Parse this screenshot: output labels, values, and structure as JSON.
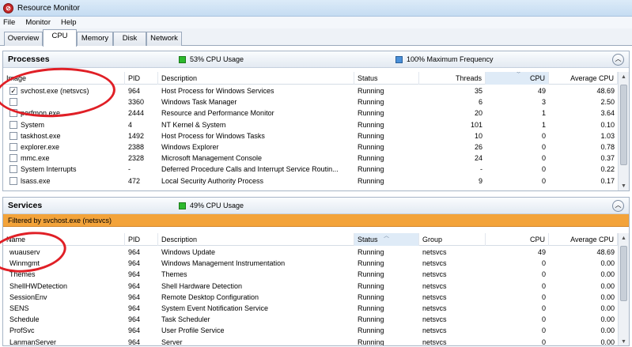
{
  "window": {
    "title": "Resource Monitor"
  },
  "menu": [
    "File",
    "Monitor",
    "Help"
  ],
  "tabs": [
    "Overview",
    "CPU",
    "Memory",
    "Disk",
    "Network"
  ],
  "processes": {
    "title": "Processes",
    "cpu_usage": "53% CPU Usage",
    "max_freq": "100% Maximum Frequency",
    "columns": [
      "Image",
      "PID",
      "Description",
      "Status",
      "Threads",
      "CPU",
      "Average CPU"
    ],
    "rows": [
      {
        "checked": true,
        "image": "svchost.exe (netsvcs)",
        "pid": "964",
        "desc": "Host Process for Windows Services",
        "status": "Running",
        "threads": "35",
        "cpu": "49",
        "avg": "48.69"
      },
      {
        "checked": false,
        "image": "",
        "pid": "3360",
        "desc": "Windows Task Manager",
        "status": "Running",
        "threads": "6",
        "cpu": "3",
        "avg": "2.50"
      },
      {
        "checked": false,
        "image": "perfmon.exe",
        "pid": "2444",
        "desc": "Resource and Performance Monitor",
        "status": "Running",
        "threads": "20",
        "cpu": "1",
        "avg": "3.64"
      },
      {
        "checked": false,
        "image": "System",
        "pid": "4",
        "desc": "NT Kernel & System",
        "status": "Running",
        "threads": "101",
        "cpu": "1",
        "avg": "0.10"
      },
      {
        "checked": false,
        "image": "taskhost.exe",
        "pid": "1492",
        "desc": "Host Process for Windows Tasks",
        "status": "Running",
        "threads": "10",
        "cpu": "0",
        "avg": "1.03"
      },
      {
        "checked": false,
        "image": "explorer.exe",
        "pid": "2388",
        "desc": "Windows Explorer",
        "status": "Running",
        "threads": "26",
        "cpu": "0",
        "avg": "0.78"
      },
      {
        "checked": false,
        "image": "mmc.exe",
        "pid": "2328",
        "desc": "Microsoft Management Console",
        "status": "Running",
        "threads": "24",
        "cpu": "0",
        "avg": "0.37"
      },
      {
        "checked": false,
        "image": "System Interrupts",
        "pid": "-",
        "desc": "Deferred Procedure Calls and Interrupt Service Routin...",
        "status": "Running",
        "threads": "-",
        "cpu": "0",
        "avg": "0.22"
      },
      {
        "checked": false,
        "image": "lsass.exe",
        "pid": "472",
        "desc": "Local Security Authority Process",
        "status": "Running",
        "threads": "9",
        "cpu": "0",
        "avg": "0.17"
      }
    ]
  },
  "services": {
    "title": "Services",
    "cpu_usage": "49% CPU Usage",
    "filter_text": "Filtered by svchost.exe (netsvcs)",
    "columns": [
      "Name",
      "PID",
      "Description",
      "Status",
      "Group",
      "CPU",
      "Average CPU"
    ],
    "rows": [
      {
        "name": "wuauserv",
        "pid": "964",
        "desc": "Windows Update",
        "status": "Running",
        "group": "netsvcs",
        "cpu": "49",
        "avg": "48.69"
      },
      {
        "name": "Winmgmt",
        "pid": "964",
        "desc": "Windows Management Instrumentation",
        "status": "Running",
        "group": "netsvcs",
        "cpu": "0",
        "avg": "0.00"
      },
      {
        "name": "Themes",
        "pid": "964",
        "desc": "Themes",
        "status": "Running",
        "group": "netsvcs",
        "cpu": "0",
        "avg": "0.00"
      },
      {
        "name": "ShellHWDetection",
        "pid": "964",
        "desc": "Shell Hardware Detection",
        "status": "Running",
        "group": "netsvcs",
        "cpu": "0",
        "avg": "0.00"
      },
      {
        "name": "SessionEnv",
        "pid": "964",
        "desc": "Remote Desktop Configuration",
        "status": "Running",
        "group": "netsvcs",
        "cpu": "0",
        "avg": "0.00"
      },
      {
        "name": "SENS",
        "pid": "964",
        "desc": "System Event Notification Service",
        "status": "Running",
        "group": "netsvcs",
        "cpu": "0",
        "avg": "0.00"
      },
      {
        "name": "Schedule",
        "pid": "964",
        "desc": "Task Scheduler",
        "status": "Running",
        "group": "netsvcs",
        "cpu": "0",
        "avg": "0.00"
      },
      {
        "name": "ProfSvc",
        "pid": "964",
        "desc": "User Profile Service",
        "status": "Running",
        "group": "netsvcs",
        "cpu": "0",
        "avg": "0.00"
      },
      {
        "name": "LanmanServer",
        "pid": "964",
        "desc": "Server",
        "status": "Running",
        "group": "netsvcs",
        "cpu": "0",
        "avg": "0.00"
      }
    ]
  },
  "colors": {
    "cpu_indicator": "#2db92d",
    "freq_indicator": "#4a90d9",
    "filter_bar": "#f3a33a",
    "annotation": "#e01f26"
  }
}
